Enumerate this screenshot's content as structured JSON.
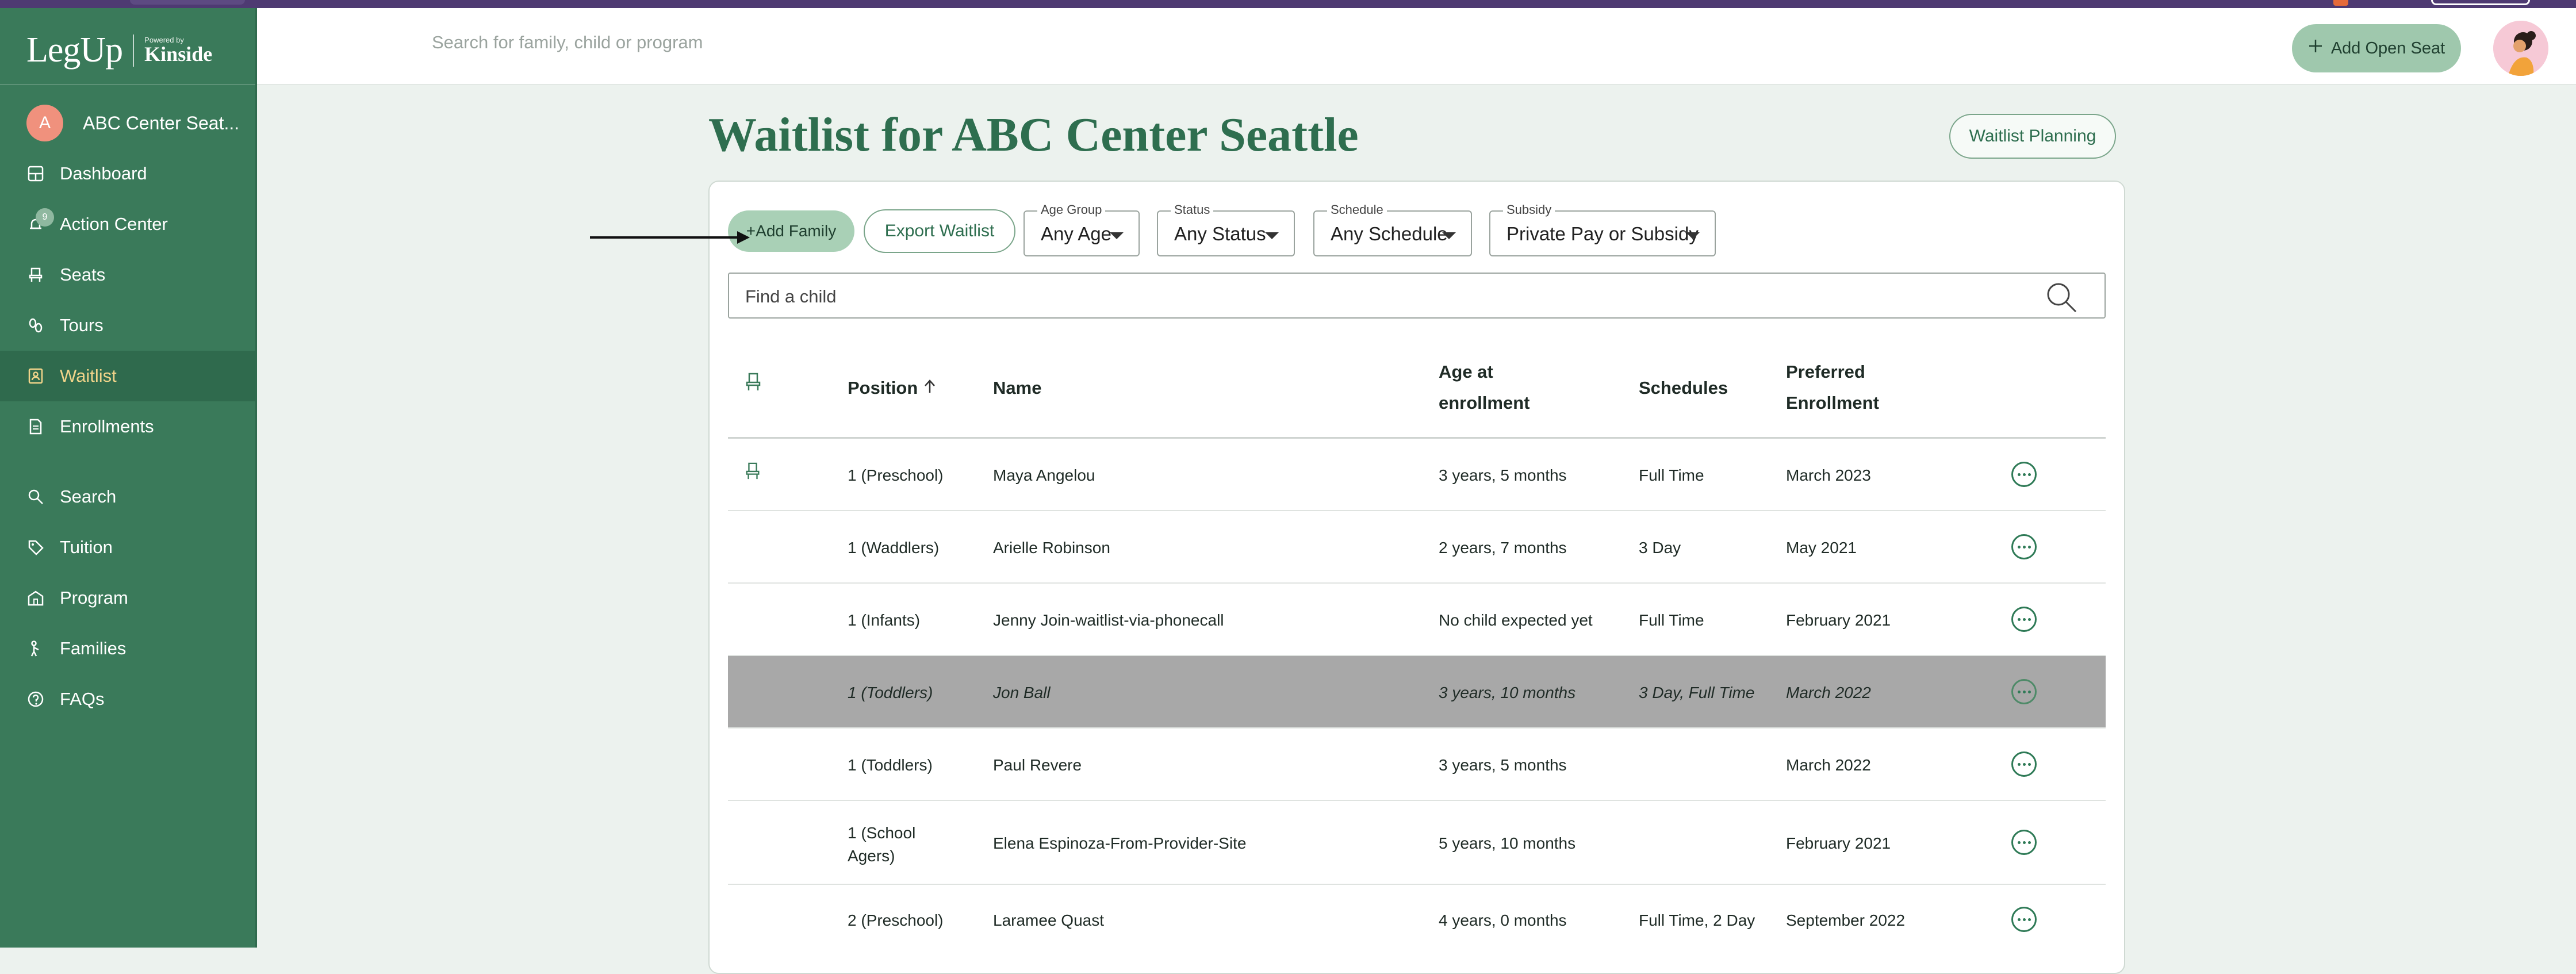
{
  "brand": {
    "logo_text": "LegUp",
    "powered_by": "Powered by",
    "partner": "Kinside"
  },
  "sidebar": {
    "center_initial": "A",
    "center_name": "ABC Center Seat...",
    "action_badge": "9",
    "items": [
      {
        "label": "Dashboard",
        "icon": "grid-icon"
      },
      {
        "label": "Action Center",
        "icon": "bell-icon"
      },
      {
        "label": "Seats",
        "icon": "chair-icon"
      },
      {
        "label": "Tours",
        "icon": "footsteps-icon"
      },
      {
        "label": "Waitlist",
        "icon": "list-icon",
        "active": true
      },
      {
        "label": "Enrollments",
        "icon": "document-icon"
      },
      {
        "label": "Search",
        "icon": "search-icon"
      },
      {
        "label": "Tuition",
        "icon": "tag-icon"
      },
      {
        "label": "Program",
        "icon": "building-icon"
      },
      {
        "label": "Families",
        "icon": "family-icon"
      },
      {
        "label": "FAQs",
        "icon": "question-icon"
      }
    ]
  },
  "topbar": {
    "search_placeholder": "Search for family, child or program",
    "add_seat_label": "Add Open Seat"
  },
  "main": {
    "title": "Waitlist for ABC Center Seattle",
    "planning_label": "Waitlist Planning",
    "add_family_label": "Add Family",
    "export_label": "Export Waitlist",
    "filters": [
      {
        "label": "Age Group",
        "value": "Any Age"
      },
      {
        "label": "Status",
        "value": "Any Status"
      },
      {
        "label": "Schedule",
        "value": "Any Schedule"
      },
      {
        "label": "Subsidy",
        "value": "Private Pay or Subsidy"
      }
    ],
    "find_placeholder": "Find a child"
  },
  "table": {
    "headers": {
      "position": "Position",
      "name": "Name",
      "age_line1": "Age at",
      "age_line2": "enrollment",
      "schedules": "Schedules",
      "pref_line1": "Preferred",
      "pref_line2": "Enrollment"
    },
    "rows": [
      {
        "position": "1 (Preschool)",
        "name": "Maya Angelou",
        "age": "3 years, 5 months",
        "schedules": "Full Time",
        "preferred": "March 2023",
        "seat_icon": true
      },
      {
        "position": "1 (Waddlers)",
        "name": "Arielle Robinson",
        "age": "2 years, 7 months",
        "schedules": "3 Day",
        "preferred": "May 2021"
      },
      {
        "position": "1 (Infants)",
        "name": "Jenny Join-waitlist-via-phonecall",
        "age": "No child expected yet",
        "schedules": "Full Time",
        "preferred": "February 2021"
      },
      {
        "position": "1 (Toddlers)",
        "name": "Jon Ball",
        "age": "3 years, 10 months",
        "schedules": "3 Day, Full Time",
        "preferred": "March 2022",
        "highlight": true
      },
      {
        "position": "1 (Toddlers)",
        "name": "Paul Revere",
        "age": "3 years, 5 months",
        "schedules": "",
        "preferred": "March 2022"
      },
      {
        "position_line1": "1 (School",
        "position_line2": "Agers)",
        "name": "Elena Espinoza-From-Provider-Site",
        "age": "5 years, 10 months",
        "schedules": "",
        "preferred": "February 2021"
      },
      {
        "position": "2 (Preschool)",
        "name": "Laramee Quast",
        "age": "4 years, 0 months",
        "schedules": "Full Time, 2 Day",
        "preferred": "September 2022"
      }
    ]
  },
  "colors": {
    "sidebar": "#3a7a5a",
    "sidebar_active": "#2f6a4d",
    "accent": "#2e6e4f",
    "button_fill": "#a9d0b6",
    "highlight_row": "#a8a8a8"
  }
}
